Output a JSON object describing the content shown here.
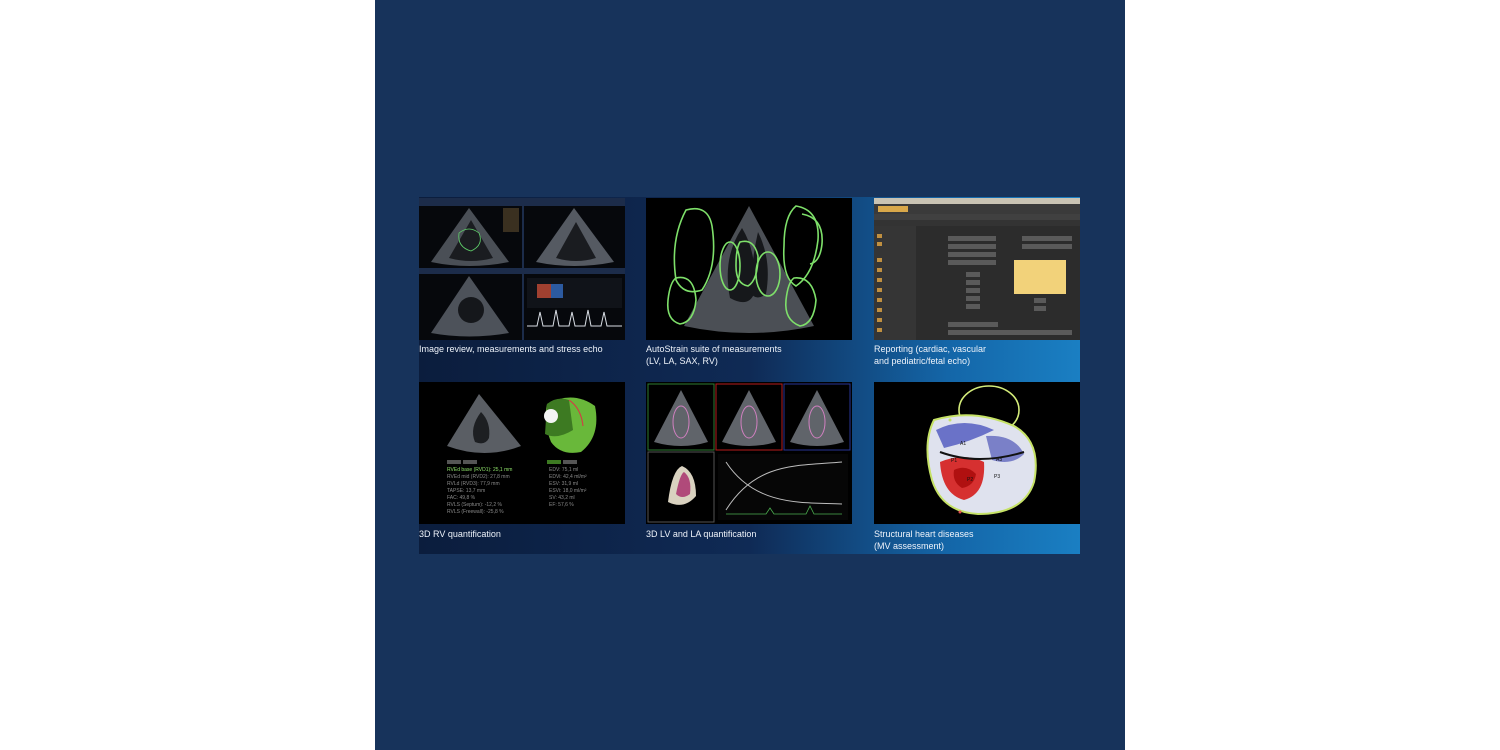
{
  "captions": {
    "image_review": [
      "Image review, measurements and stress echo"
    ],
    "autostrain": [
      "AutoStrain suite of measurements",
      "(LV, LA, SAX, RV)"
    ],
    "reporting": [
      "Reporting (cardiac, vascular",
      "and pediatric/fetal echo)"
    ],
    "rv_3d": [
      "3D RV quantification"
    ],
    "lv_la_3d": [
      "3D LV and LA quantification"
    ],
    "structural": [
      "Structural heart diseases",
      "(MV assessment)"
    ]
  },
  "rv_measurements": {
    "left": [
      "RVEd base (RVD1): 25,1 mm",
      "RVEd mid (RVD2): 27,8 mm",
      "RVLd (RVD3): 77,9 mm",
      "TAPSE: 13,7 mm",
      "FAC: 49,8 %",
      "RVLS (Septum): -12,2 %",
      "RVLS (Freewall): -25,8 %"
    ],
    "right": [
      "EDV: 75,1 ml",
      "EDVi: 42,4 ml/m²",
      "ESV: 31,9 ml",
      "ESVi: 18,0 ml/m²",
      "SV: 43,2 ml",
      "EF: 57,6 %"
    ]
  },
  "mv_labels": [
    "A1",
    "P1",
    "A3",
    "P3",
    "P2"
  ],
  "colors": {
    "background": "#17335b",
    "band_start": "#0b1d3d",
    "band_end": "#1a7fc3",
    "contour_green": "#7ee06a",
    "measure_green": "#8fe26a"
  }
}
